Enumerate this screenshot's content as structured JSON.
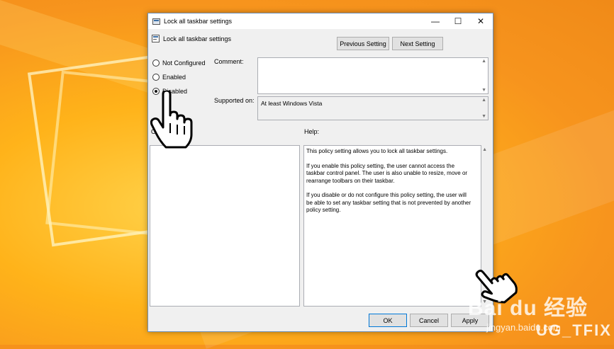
{
  "window": {
    "title": "Lock all taskbar settings",
    "header_title": "Lock all taskbar settings",
    "min_glyph": "—",
    "max_glyph": "☐",
    "close_glyph": "✕"
  },
  "nav": {
    "previous_label": "Previous Setting",
    "next_label": "Next Setting"
  },
  "state": {
    "options": [
      "Not Configured",
      "Enabled",
      "Disabled"
    ],
    "selected": "Disabled"
  },
  "comment": {
    "label": "Comment:",
    "value": ""
  },
  "supported": {
    "label": "Supported on:",
    "value": "At least Windows Vista"
  },
  "options_label": "O",
  "help": {
    "label": "Help:",
    "paragraphs": [
      "This policy setting allows you to lock all taskbar settings.",
      "If you enable this policy setting, the user cannot access the taskbar control panel. The user is also unable to resize, move or rearrange toolbars on their taskbar.",
      "If you disable or do not configure this policy setting, the user will be able to set any taskbar setting that is not prevented by another policy setting."
    ]
  },
  "footer": {
    "ok_label": "OK",
    "cancel_label": "Cancel",
    "apply_label": "Apply"
  },
  "watermarks": {
    "baidu": "Bai du 经验",
    "site": "jingyan.baidu.com",
    "brand": "UG_TFIX"
  },
  "icons": [
    "policy-window-icon",
    "policy-header-icon",
    "hand-pointer-icon"
  ]
}
